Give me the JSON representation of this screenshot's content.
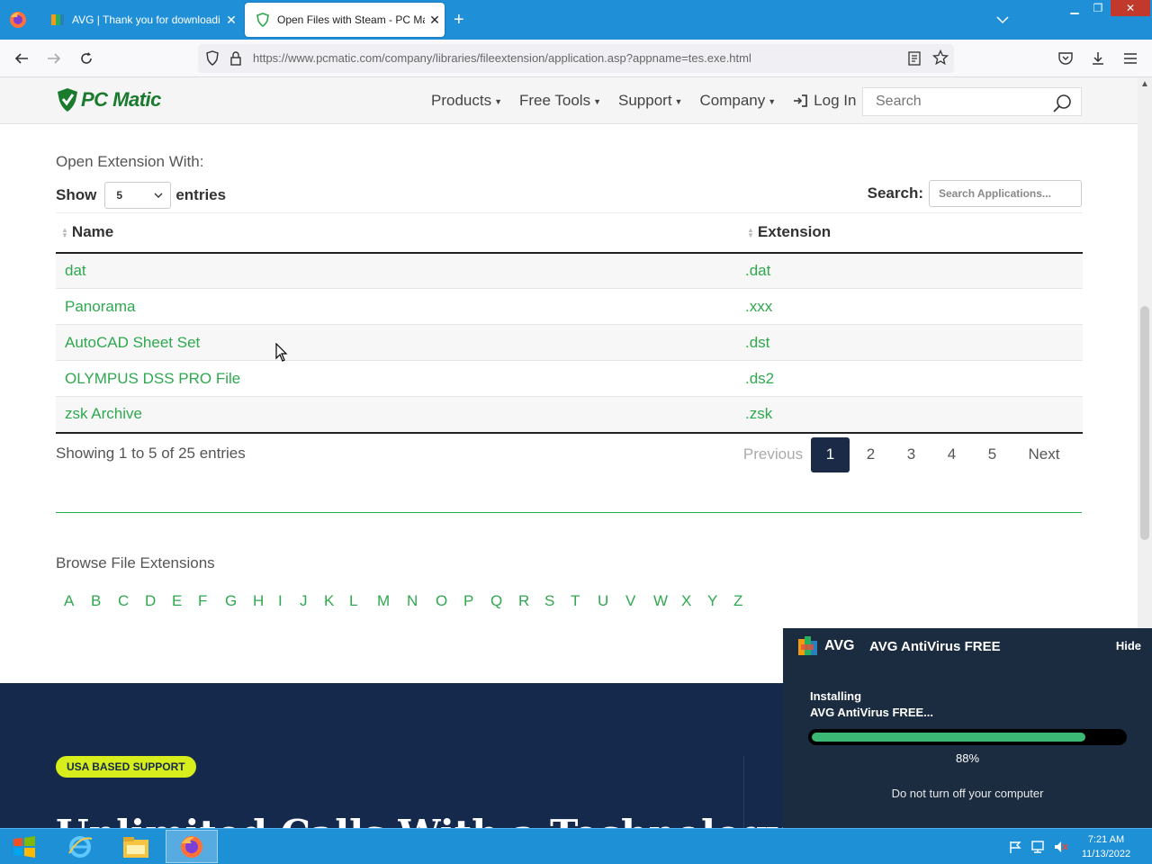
{
  "browser": {
    "tabs": [
      {
        "title": "AVG | Thank you for downloadi",
        "active": false
      },
      {
        "title": "Open Files with Steam - PC Ma",
        "active": true
      }
    ],
    "url": "https://www.pcmatic.com/company/libraries/fileextension/application.asp?appname=tes.exe.html"
  },
  "site": {
    "logo": "PC Matic",
    "nav": [
      {
        "label": "Products"
      },
      {
        "label": "Free Tools"
      },
      {
        "label": "Support"
      },
      {
        "label": "Company"
      }
    ],
    "login": "Log In",
    "search_placeholder": "Search"
  },
  "main": {
    "section_title": "Open Extension With:",
    "show_label": "Show",
    "entries_label": "entries",
    "page_size": "5",
    "search_label": "Search:",
    "search_placeholder": "Search Applications...",
    "columns": [
      "Name",
      "Extension"
    ],
    "rows": [
      {
        "name": "dat",
        "ext": ".dat"
      },
      {
        "name": "Panorama",
        "ext": ".xxx"
      },
      {
        "name": "AutoCAD Sheet Set",
        "ext": ".dst"
      },
      {
        "name": "OLYMPUS DSS PRO File",
        "ext": ".ds2"
      },
      {
        "name": "zsk Archive",
        "ext": ".zsk"
      }
    ],
    "info": "Showing 1 to 5 of 25 entries",
    "pagination": {
      "previous": "Previous",
      "pages": [
        "1",
        "2",
        "3",
        "4",
        "5"
      ],
      "current": "1",
      "next": "Next"
    },
    "browse_title": "Browse File Extensions",
    "letters": [
      "A",
      "B",
      "C",
      "D",
      "E",
      "F",
      "G",
      "H",
      "I",
      "J",
      "K",
      "L",
      "M",
      "N",
      "O",
      "P",
      "Q",
      "R",
      "S",
      "T",
      "U",
      "V",
      "W",
      "X",
      "Y",
      "Z"
    ]
  },
  "footer": {
    "badge": "USA BASED SUPPORT",
    "headline": "Unlimited Calls With a Technology"
  },
  "avg_popup": {
    "brand": "AVG",
    "title": "AVG AntiVirus FREE",
    "hide": "Hide",
    "status_line1": "Installing",
    "status_line2": "AVG AntiVirus FREE...",
    "progress": 0.88,
    "progress_label": "88%",
    "note": "Do not turn off your computer"
  },
  "taskbar": {
    "time": "7:21 AM",
    "date": "11/13/2022"
  },
  "colors": {
    "tab_bar": "#1f8fd8",
    "link_green": "#2fa84f",
    "pager_active": "#1b2a47",
    "footer_band": "#15294d",
    "badge": "#d7ee1c",
    "avg_bg": "#1b2b40",
    "avg_progress": "#3bb874",
    "taskbar": "#1e90d6"
  }
}
